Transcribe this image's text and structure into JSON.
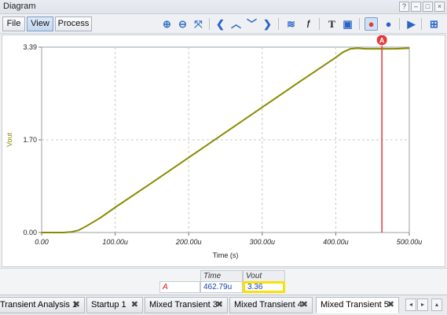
{
  "window": {
    "title": "Diagram",
    "controls": [
      "?",
      "–",
      "□",
      "×"
    ]
  },
  "toolbar": {
    "tabs": [
      "File",
      "View",
      "Process"
    ],
    "active_tab": "View",
    "icons": [
      "zoom-in-icon",
      "zoom-out-icon",
      "zoom-fit-icon",
      "arrow-left-icon",
      "arrow-up-icon",
      "arrow-down-icon",
      "arrow-right-icon",
      "waveform-icon",
      "function-icon",
      "text-icon",
      "comment-icon",
      "cursor-a-icon",
      "cursor-b-icon",
      "run-icon",
      "add-icon"
    ]
  },
  "colors": {
    "trace": "#8a8a00",
    "cursor": "#e23b3b",
    "axis_label": "#8a8a00",
    "highlight": "#f7e10a"
  },
  "chart_data": {
    "type": "line",
    "xlabel": "Time (s)",
    "ylabel": "Vout",
    "xlim": [
      0,
      500
    ],
    "ylim": [
      0,
      3.39
    ],
    "x_ticks": [
      "0.00",
      "100.00u",
      "200.00u",
      "300.00u",
      "400.00u",
      "500.00u"
    ],
    "y_ticks": [
      "0.00",
      "1.70",
      "3.39"
    ],
    "grid": true,
    "series": [
      {
        "name": "Vout",
        "x": [
          0,
          30,
          40,
          50,
          60,
          80,
          100,
          150,
          200,
          250,
          300,
          350,
          400,
          410,
          420,
          430,
          440,
          460,
          480,
          500
        ],
        "y": [
          0.0,
          0.0,
          0.01,
          0.04,
          0.11,
          0.27,
          0.46,
          0.91,
          1.37,
          1.83,
          2.29,
          2.75,
          3.2,
          3.3,
          3.36,
          3.37,
          3.36,
          3.36,
          3.36,
          3.37
        ]
      }
    ],
    "cursor": {
      "label": "A",
      "x": 462.79
    }
  },
  "readout": {
    "headers": [
      "Time",
      "Vout"
    ],
    "rows": [
      {
        "name": "A",
        "time": "462.79u",
        "value": "3.36"
      }
    ]
  },
  "tabs": {
    "items": [
      "Transient Analysis 1",
      "Startup 1",
      "Mixed Transient 3",
      "Mixed Transient 4",
      "Mixed Transient 5"
    ],
    "active": "Mixed Transient 5",
    "close_glyph": "✖",
    "nav": [
      "◂",
      "▸",
      "▴"
    ]
  }
}
